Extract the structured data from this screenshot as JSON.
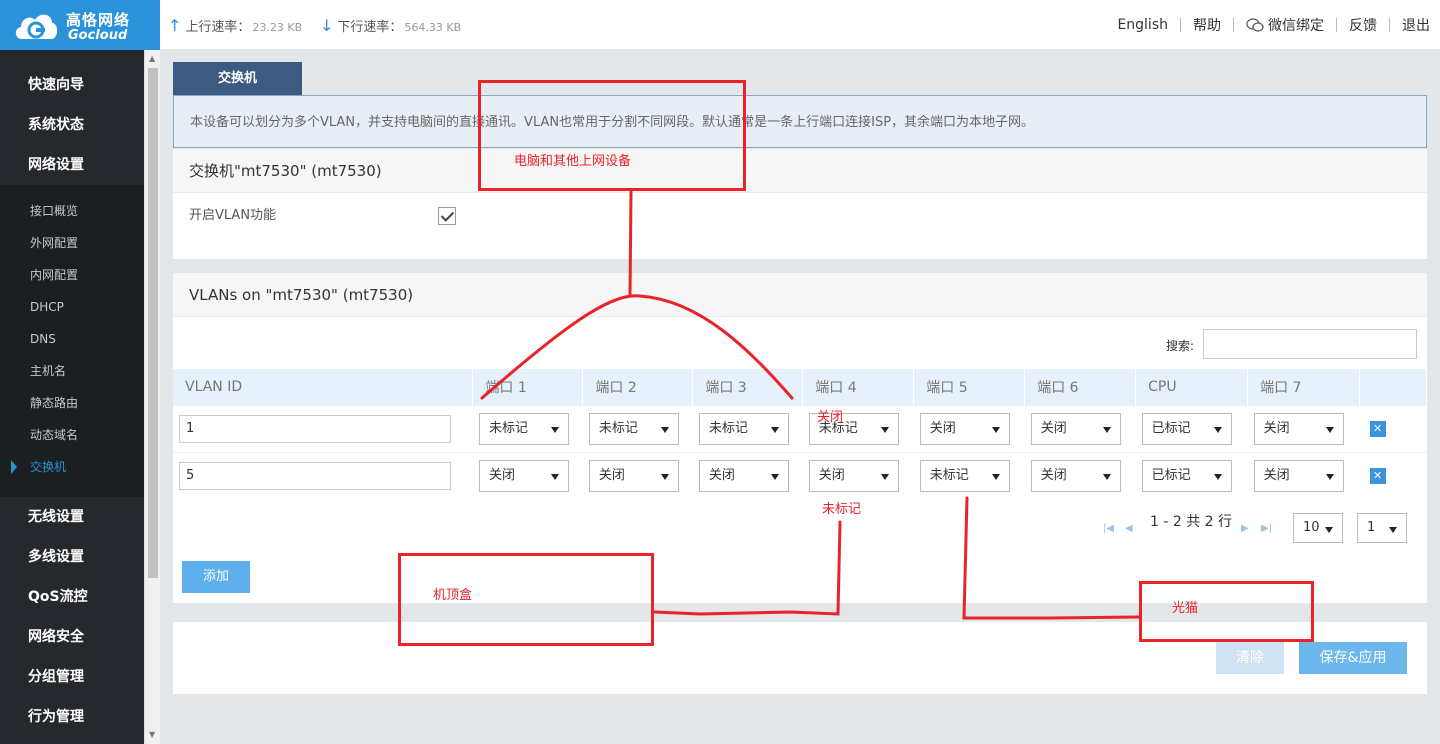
{
  "brand": {
    "name_cn": "高恪网络",
    "name_en": "Gocloud",
    "logo_icon": "cloud-icon"
  },
  "header": {
    "upload_label": "上行速率：",
    "upload_value": "23.23 KB",
    "download_label": "下行速率：",
    "download_value": "564.33 KB",
    "nav": [
      "English",
      "帮助",
      "微信绑定",
      "反馈",
      "退出"
    ]
  },
  "sidebar": {
    "items": [
      "快速向导",
      "系统状态",
      "网络设置"
    ],
    "sub_items": [
      "接口概览",
      "外网配置",
      "内网配置",
      "DHCP",
      "DNS",
      "主机名",
      "静态路由",
      "动态域名",
      "交换机"
    ],
    "active_sub": "交换机",
    "items_after": [
      "无线设置",
      "多线设置",
      "QoS流控",
      "网络安全",
      "分组管理",
      "行为管理"
    ]
  },
  "tab": {
    "label": "交换机"
  },
  "notice": "本设备可以划分为多个VLAN，并支持电脑间的直接通讯。VLAN也常用于分割不同网段。默认通常是一条上行端口连接ISP，其余端口为本地子网。",
  "switch_panel": {
    "title": "交换机\"mt7530\" (mt7530)",
    "enable_label": "开启VLAN功能",
    "enabled": true
  },
  "vlan_panel": {
    "title": "VLANs on \"mt7530\" (mt7530)",
    "search_label": "搜索:",
    "search_value": "",
    "columns": [
      "VLAN ID",
      "端口 1",
      "端口 2",
      "端口 3",
      "端口 4",
      "端口 5",
      "端口 6",
      "CPU",
      "端口 7"
    ],
    "rows": [
      {
        "id": "1",
        "ports": [
          "未标记",
          "未标记",
          "未标记",
          "未标记",
          "关闭",
          "关闭",
          "已标记",
          "关闭"
        ]
      },
      {
        "id": "5",
        "ports": [
          "关闭",
          "关闭",
          "关闭",
          "关闭",
          "未标记",
          "关闭",
          "已标记",
          "关闭"
        ]
      }
    ],
    "pager_text": "1 - 2 共 2 行",
    "page_size": "10",
    "page": "1",
    "add_label": "添加"
  },
  "actions": {
    "clear_label": "清除",
    "save_label": "保存&应用"
  },
  "annotations": {
    "pc_label": "电脑和其他上网设备",
    "off_label": "关闭",
    "untagged_label": "未标记",
    "stb_label": "机顶盒",
    "modem_label": "光猫"
  },
  "colors": {
    "accent": "#2a93d9",
    "sidebar_bg": "#25292d",
    "annotation": "#e8232a",
    "tab_bg": "#3d5a80"
  }
}
